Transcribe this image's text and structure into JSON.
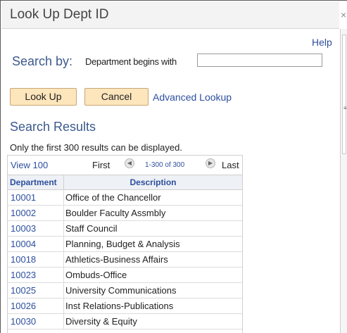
{
  "window": {
    "title": "Look Up Dept ID",
    "close_glyph": "×"
  },
  "help_label": "Help",
  "search": {
    "by_label": "Search by:",
    "field_label": "Department begins with",
    "value": ""
  },
  "buttons": {
    "lookup": "Look Up",
    "cancel": "Cancel",
    "advanced": "Advanced Lookup"
  },
  "results": {
    "title": "Search Results",
    "note": "Only the first 300 results can be displayed.",
    "view_label": "View 100",
    "first_label": "First",
    "range_label": "1-300 of 300",
    "last_label": "Last",
    "columns": [
      "Department",
      "Description"
    ],
    "rows": [
      {
        "code": "10001",
        "description": "Office of the Chancellor"
      },
      {
        "code": "10002",
        "description": "Boulder Faculty Assmbly"
      },
      {
        "code": "10003",
        "description": "Staff Council"
      },
      {
        "code": "10004",
        "description": "Planning, Budget & Analysis"
      },
      {
        "code": "10018",
        "description": "Athletics-Business Affairs"
      },
      {
        "code": "10023",
        "description": "Ombuds-Office"
      },
      {
        "code": "10025",
        "description": "University Communications"
      },
      {
        "code": "10026",
        "description": "Inst Relations-Publications"
      },
      {
        "code": "10030",
        "description": "Diversity & Equity"
      }
    ]
  },
  "icons": {
    "prev": "◀",
    "next": "▶",
    "scroll_grip": "≡"
  },
  "colors": {
    "link": "#2d4f9e",
    "heading": "#3c5a8c",
    "button_bg": "#fde5bc",
    "button_border": "#c9a677",
    "header_bg": "#eef1f5"
  }
}
